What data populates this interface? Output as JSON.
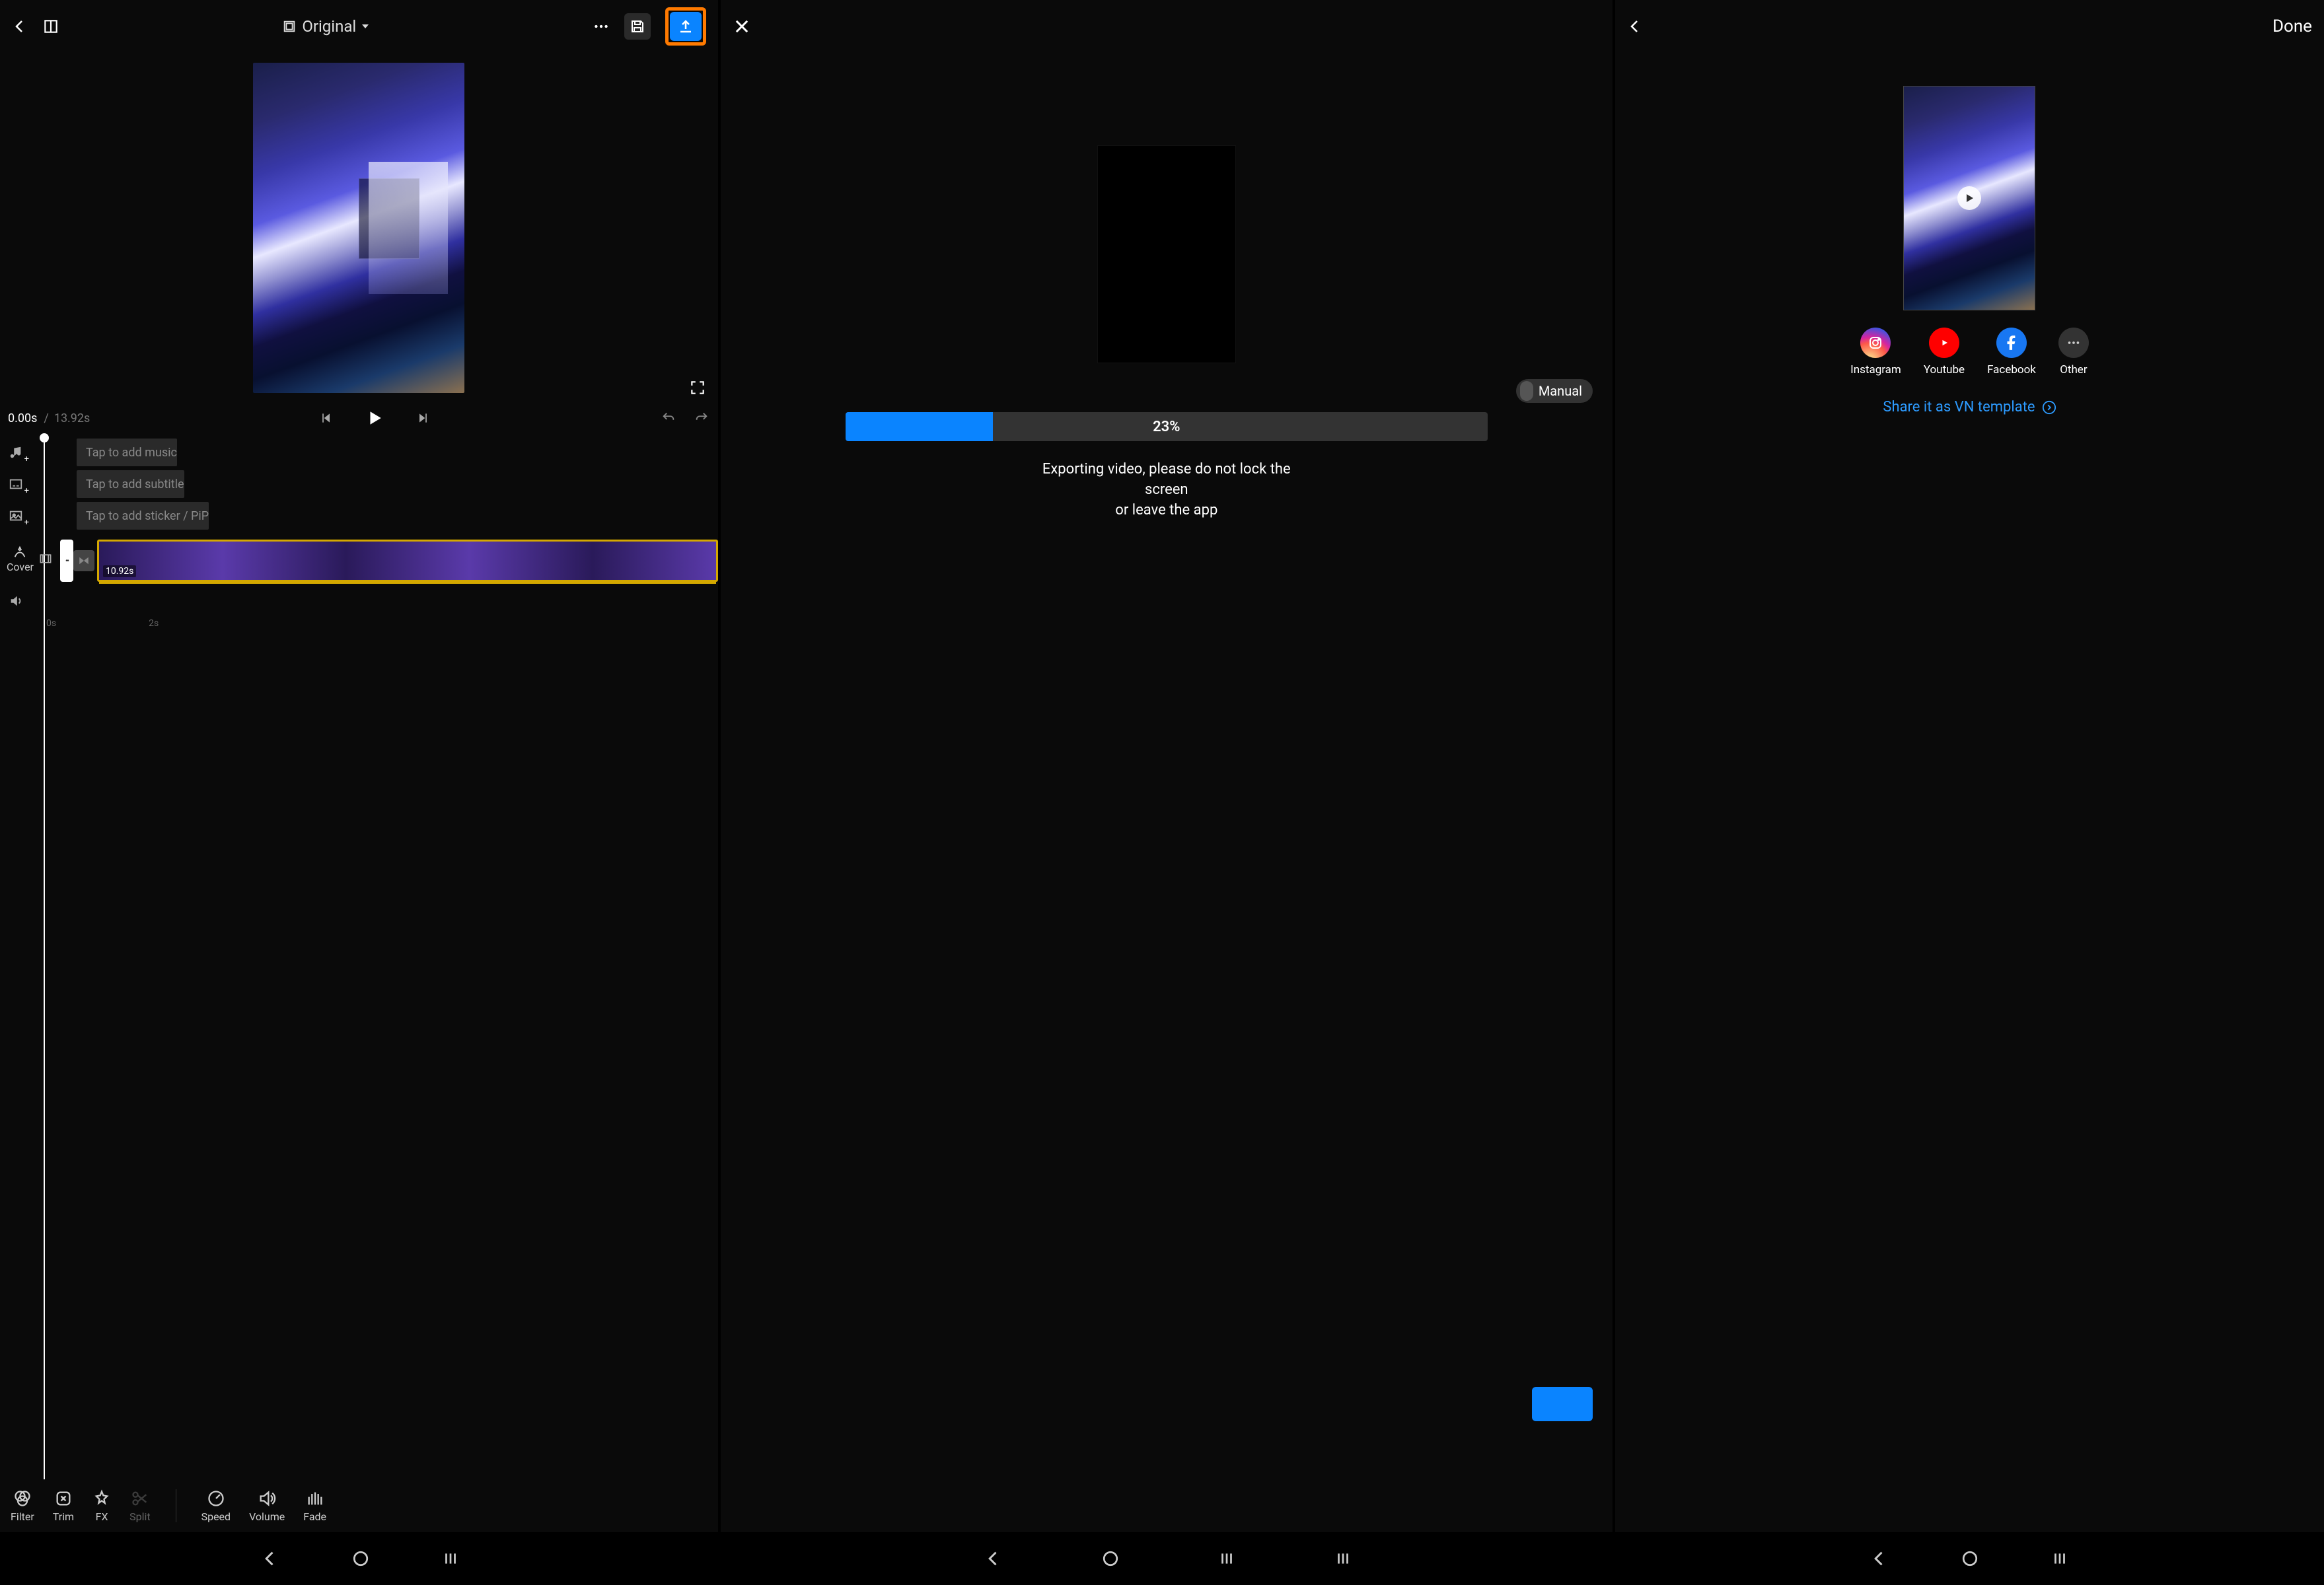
{
  "screen1": {
    "ratio_label": "Original",
    "time_current": "0.00s",
    "time_separator": "/",
    "time_duration": "13.92s",
    "tracks": {
      "music": "Tap to add music",
      "subtitle": "Tap to add subtitle",
      "sticker": "Tap to add sticker / PiP"
    },
    "clip_duration": "10.92s",
    "cover_label": "Cover",
    "ruler": {
      "t0": "0s",
      "t1": "2s"
    },
    "tools": {
      "filter": "Filter",
      "trim": "Trim",
      "fx": "FX",
      "split": "Split",
      "speed": "Speed",
      "volume": "Volume",
      "fade": "Fade"
    }
  },
  "screen2": {
    "manual_label": "Manual",
    "progress_text": "23%",
    "progress_value": 23,
    "export_message_l1": "Exporting video, please do not lock the screen",
    "export_message_l2": "or leave the app"
  },
  "screen3": {
    "done_label": "Done",
    "share": {
      "instagram": "Instagram",
      "youtube": "Youtube",
      "facebook": "Facebook",
      "other": "Other"
    },
    "template_link": "Share it as VN template"
  }
}
